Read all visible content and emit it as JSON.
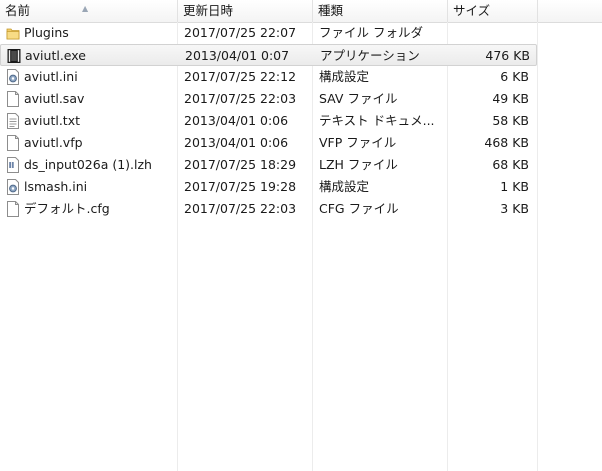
{
  "columns": {
    "name": "名前",
    "date": "更新日時",
    "type": "種類",
    "size": "サイズ"
  },
  "files": [
    {
      "name": "Plugins",
      "date": "2017/07/25 22:07",
      "type": "ファイル フォルダ",
      "size": "",
      "icon": "folder-icon"
    },
    {
      "name": "aviutl.exe",
      "date": "2013/04/01 0:07",
      "type": "アプリケーション",
      "size": "476 KB",
      "icon": "exe-icon"
    },
    {
      "name": "aviutl.ini",
      "date": "2017/07/25 22:12",
      "type": "構成設定",
      "size": "6 KB",
      "icon": "settings-file-icon"
    },
    {
      "name": "aviutl.sav",
      "date": "2017/07/25 22:03",
      "type": "SAV ファイル",
      "size": "49 KB",
      "icon": "file-icon"
    },
    {
      "name": "aviutl.txt",
      "date": "2013/04/01 0:06",
      "type": "テキスト ドキュメ...",
      "size": "58 KB",
      "icon": "text-file-icon"
    },
    {
      "name": "aviutl.vfp",
      "date": "2013/04/01 0:06",
      "type": "VFP ファイル",
      "size": "468 KB",
      "icon": "file-icon"
    },
    {
      "name": "ds_input026a (1).lzh",
      "date": "2017/07/25 18:29",
      "type": "LZH ファイル",
      "size": "68 KB",
      "icon": "archive-icon"
    },
    {
      "name": "lsmash.ini",
      "date": "2017/07/25 19:28",
      "type": "構成設定",
      "size": "1 KB",
      "icon": "settings-file-icon"
    },
    {
      "name": "デフォルト.cfg",
      "date": "2017/07/25 22:03",
      "type": "CFG ファイル",
      "size": "3 KB",
      "icon": "file-icon"
    }
  ],
  "selected_file": "aviutl.exe"
}
